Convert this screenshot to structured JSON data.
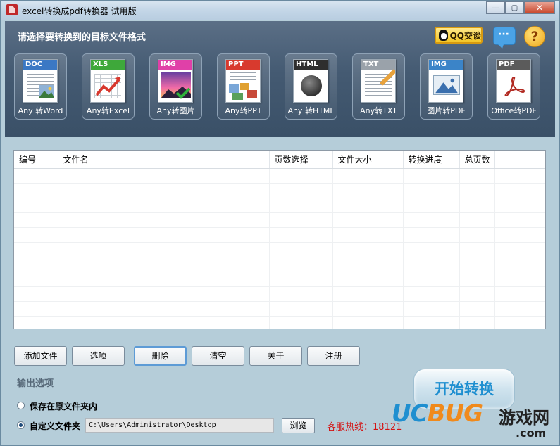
{
  "window": {
    "title": "excel转换成pdf转换器 试用版",
    "controls": {
      "minimize": "—",
      "maximize": "▢",
      "close": "✕"
    }
  },
  "header": {
    "title": "请选择要转换到的目标文件格式",
    "qq_button": "QQ交谈",
    "chat_icon": "chat-bubble-icon",
    "help_icon": "?",
    "formats": [
      {
        "tag": "DOC",
        "label": "Any 转Word",
        "color": "#3b78c4"
      },
      {
        "tag": "XLS",
        "label": "Any转Excel",
        "color": "#3ea83a"
      },
      {
        "tag": "IMG",
        "label": "Any转图片",
        "color": "#e040a8"
      },
      {
        "tag": "PPT",
        "label": "Any转PPT",
        "color": "#d83a2e"
      },
      {
        "tag": "HTML",
        "label": "Any 转HTML",
        "color": "#2e2e2e"
      },
      {
        "tag": "TXT",
        "label": "Any转TXT",
        "color": "#9aa2aa"
      },
      {
        "tag": "IMG",
        "label": "图片转PDF",
        "color": "#3b84c8"
      },
      {
        "tag": "PDF",
        "label": "Office转PDF",
        "color": "#5b5b5b"
      }
    ]
  },
  "table": {
    "columns": [
      "编号",
      "文件名",
      "页数选择",
      "文件大小",
      "转换进度",
      "总页数",
      ""
    ],
    "rows": []
  },
  "buttons": {
    "add_file": "添加文件",
    "options": "选项",
    "delete": "删除",
    "clear": "清空",
    "about": "关于",
    "register": "注册"
  },
  "output": {
    "label": "输出选项",
    "option_original": "保存在原文件夹内",
    "option_custom": "自定义文件夹",
    "selected": "custom",
    "path": "C:\\Users\\Administrator\\Desktop",
    "browse": "浏览"
  },
  "start_button": "开始转换",
  "hotline": "客服热线：18121",
  "watermark": {
    "brand": "UCBUG",
    "cn": "游戏网",
    "domain": ".com"
  }
}
